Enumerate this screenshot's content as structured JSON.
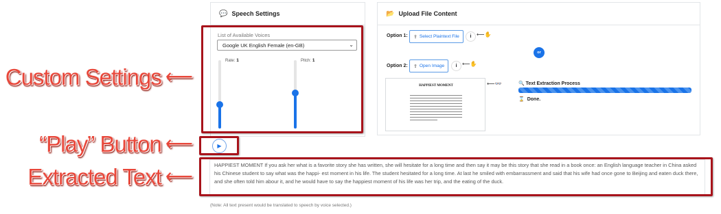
{
  "annotations": {
    "custom_settings": "Custom Settings",
    "play_button": "“Play” Button",
    "extracted_text": "Extracted Text",
    "arrow": "⟵"
  },
  "speech_settings": {
    "title": "Speech Settings",
    "icon": "speech-bubble-icon",
    "voice_list_label": "List of Available Voices",
    "selected_voice": "Google UK English Female (en-GB)",
    "rate_label": "Rate:",
    "rate_value": "1",
    "pitch_label": "Pitch:",
    "pitch_value": "1",
    "rate_level": 0.35,
    "pitch_level": 0.52
  },
  "upload": {
    "title": "Upload File Content",
    "icon": "folder-icon",
    "option1_label": "Option 1:",
    "option1_button": "Select Plaintext File",
    "option2_label": "Option 2:",
    "option2_button": "Open Image",
    "or_label": "or",
    "info_label": "i",
    "thumbnail_title": "HAPPIEST MOMENT",
    "extraction_title": "Text Extraction Process",
    "extraction_progress": 1.0,
    "status": "Done."
  },
  "play": {
    "icon": "play-icon",
    "glyph": "▶"
  },
  "extracted": {
    "text": "HAPPIEST MOMENT If you ask her what is a favorite story she has written, she will hesitate for a long time and then say it may be this story that she read in a book once: an English language teacher in China asked his Chinese student to say what was the happi- est moment in his life. The student hesitated for a long time. At last he smiled with embarrassment and said that his wife had once gone to Beijing and eaten duck there, and she often told him abour it, and he would have to say the happiest moment of his life was her trip, and the eating of the duck.",
    "note": "(Note: All text present would be translated to speech by voice selected.)"
  },
  "colors": {
    "accent": "#1a73e8",
    "annotation_red": "#e8473a",
    "annotation_box": "#a8131b"
  }
}
